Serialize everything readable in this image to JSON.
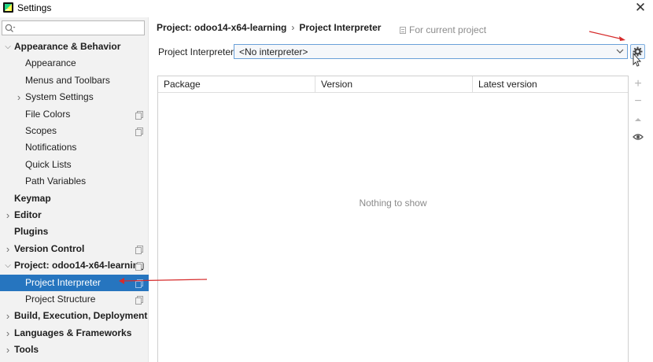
{
  "window": {
    "title": "Settings",
    "close_glyph": "✕"
  },
  "sidebar": {
    "search_placeholder": "",
    "items": [
      {
        "label": "Appearance & Behavior",
        "bold": true,
        "arrow": "expanded"
      },
      {
        "label": "Appearance"
      },
      {
        "label": "Menus and Toolbars"
      },
      {
        "label": "System Settings",
        "arrow": "collapsed"
      },
      {
        "label": "File Colors",
        "copy_icon": true
      },
      {
        "label": "Scopes",
        "copy_icon": true
      },
      {
        "label": "Notifications"
      },
      {
        "label": "Quick Lists"
      },
      {
        "label": "Path Variables"
      },
      {
        "label": "Keymap",
        "bold": true
      },
      {
        "label": "Editor",
        "bold": true,
        "arrow": "collapsed"
      },
      {
        "label": "Plugins",
        "bold": true
      },
      {
        "label": "Version Control",
        "bold": true,
        "arrow": "collapsed",
        "copy_icon": true
      },
      {
        "label": "Project: odoo14-x64-learning",
        "bold": true,
        "arrow": "expanded",
        "copy_icon": true
      },
      {
        "label": "Project Interpreter",
        "selected": true,
        "copy_icon": true
      },
      {
        "label": "Project Structure",
        "copy_icon": true
      },
      {
        "label": "Build, Execution, Deployment",
        "bold": true,
        "arrow": "collapsed"
      },
      {
        "label": "Languages & Frameworks",
        "bold": true,
        "arrow": "collapsed"
      },
      {
        "label": "Tools",
        "bold": true,
        "arrow": "collapsed"
      }
    ]
  },
  "breadcrumb": {
    "project": "Project: odoo14-x64-learning",
    "separator": "›",
    "page": "Project Interpreter",
    "scope_note": "For current project"
  },
  "interpreter": {
    "label": "Project Interpreter:",
    "selected_value": "<No interpreter>",
    "settings_icon": "gear-icon"
  },
  "packages": {
    "columns": [
      "Package",
      "Version",
      "Latest version"
    ],
    "empty_text": "Nothing to show",
    "toolbar": {
      "add": "+",
      "remove": "−"
    }
  },
  "annotation_color": "#d62b2b"
}
